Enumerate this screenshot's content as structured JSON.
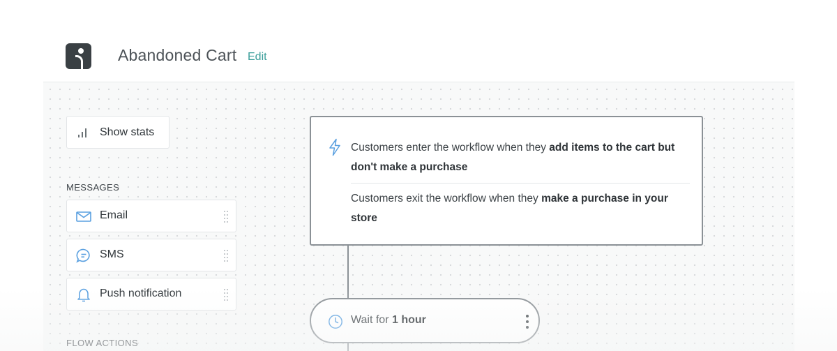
{
  "header": {
    "title": "Abandoned Cart",
    "edit_label": "Edit"
  },
  "toolbar": {
    "show_stats_label": "Show stats"
  },
  "sidebar": {
    "messages_heading": "MESSAGES",
    "messages": [
      {
        "label": "Email",
        "icon": "envelope-icon"
      },
      {
        "label": "SMS",
        "icon": "chat-bubble-icon"
      },
      {
        "label": "Push notification",
        "icon": "bell-icon"
      }
    ],
    "flow_actions_heading": "FLOW ACTIONS"
  },
  "workflow": {
    "trigger": {
      "enter_prefix": "Customers enter the workflow when they ",
      "enter_bold": "add items to the cart but don't make a purchase",
      "exit_prefix": "Customers exit the workflow when they ",
      "exit_bold": "make a purchase in your store"
    },
    "wait": {
      "prefix": "Wait for ",
      "duration": "1 hour"
    }
  },
  "colors": {
    "accent": "#3a9e9a",
    "icon_blue": "#5aa0e0",
    "node_border": "#8b9196",
    "logo_bg": "#3a4044"
  }
}
